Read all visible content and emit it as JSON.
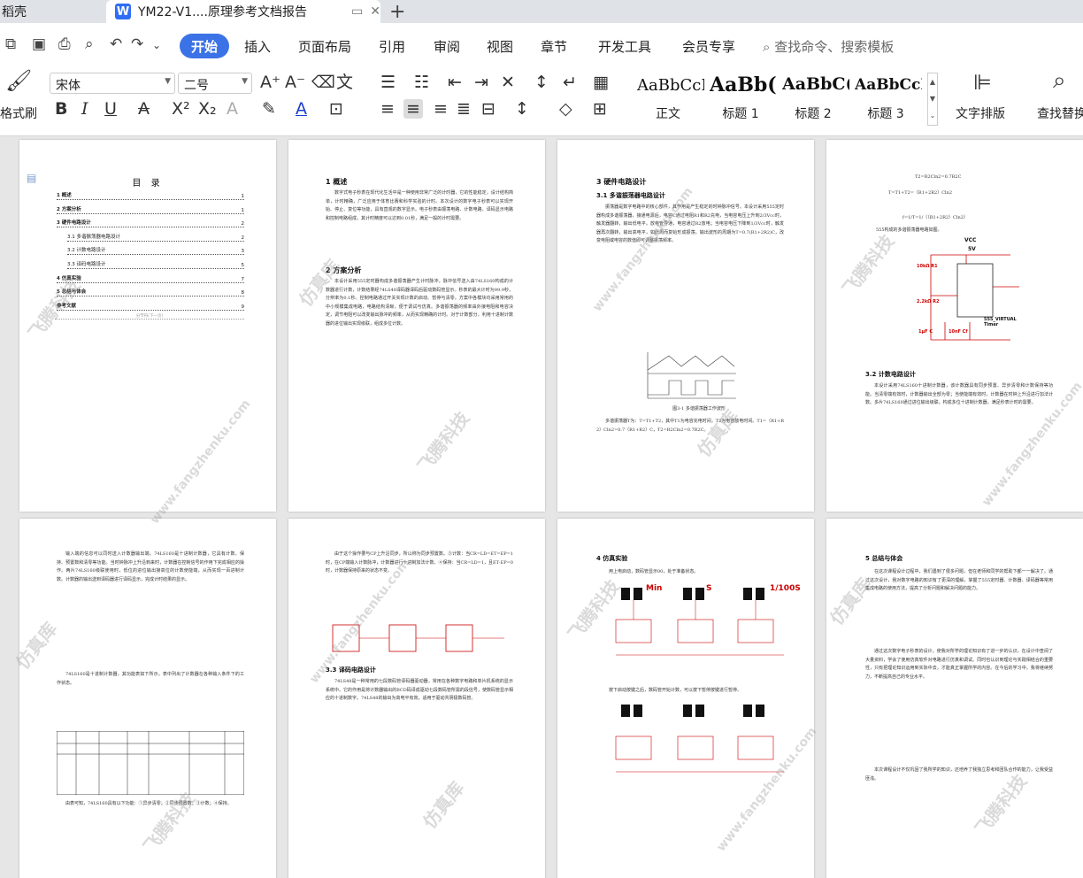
{
  "tabs": {
    "left_tab": "稻壳",
    "active_doc_icon": "W",
    "active_tab": "YM22-V1....原理参考文档报告",
    "new_tab": "+"
  },
  "menu": {
    "items": [
      "开始",
      "插入",
      "页面布局",
      "引用",
      "审阅",
      "视图",
      "章节",
      "开发工具",
      "会员专享"
    ],
    "active": "开始",
    "search": "查找命令、搜索模板"
  },
  "ribbon": {
    "format_painter": "格式刷",
    "font_name": "宋体",
    "font_size": "二号",
    "styles": [
      {
        "sample": "AaBbCcI",
        "name": "正文"
      },
      {
        "sample": "AaBb(",
        "name": "标题 1"
      },
      {
        "sample": "AaBbC(",
        "name": "标题 2"
      },
      {
        "sample": "AaBbCcI",
        "name": "标题 3"
      }
    ],
    "text_layout": "文字排版",
    "find_replace": "查找替换"
  },
  "watermark": {
    "text1": "飞腾科技",
    "text2": "仿真库",
    "url": "www.fangzhenku.com"
  },
  "pages": {
    "p1": {
      "title": "目 录",
      "toc": [
        {
          "t": "1 概述",
          "n": "1",
          "bold": true
        },
        {
          "t": "2 方案分析",
          "n": "1",
          "bold": true
        },
        {
          "t": "3 硬件电路设计",
          "n": "2",
          "bold": true
        },
        {
          "t": "3.1 多谐振荡器电路设计",
          "n": "2",
          "bold": false
        },
        {
          "t": "3.2 计数电路设计",
          "n": "3",
          "bold": false
        },
        {
          "t": "3.3 译码电路设计",
          "n": "5",
          "bold": false
        },
        {
          "t": "4 仿真实验",
          "n": "7",
          "bold": true
        },
        {
          "t": "5 总结与体会",
          "n": "8",
          "bold": true
        },
        {
          "t": "参考文献",
          "n": "9",
          "bold": true
        }
      ],
      "section_break": "分节符(下一页)"
    },
    "p2": {
      "h1": "1 概述",
      "t1": "数字式电子秒表在现代化生活中是一种使用非常广泛的计时器，它的性能稳定，设计结构简单，计时精确，广泛应用于体育比赛和科学实验的计时。本次设计的数字电子秒表可以实现开始、停止、复位等功能，具有直观的数字显示。电子秒表由振荡电路、计数电路、译码显示电路和控制电路组成，其计时精度可以达到0.01秒，满足一般的计时需要。",
      "h2": "2 方案分析",
      "t2": "本设计采用555定时器构成多谐振荡器产生计时脉冲，脉冲信号送入由74LS160构成的计数器进行计数，计数结果经74LS48译码器译码后驱动数码管显示。秒表的最大计时为99.9秒，分辨率为0.1秒。控制电路通过开关实现计数的启动、暂停与清零。方案中各模块均采用常用的中小规模集成电路，电路结构清晰，便于调试与仿真。多谐振荡器的频率由外接电阻和电容决定，调节电阻可以改变输出脉冲的频率，从而实现精确的计时。对于计数部分，利用十进制计数器的进位输出实现级联，组成多位计数。"
    },
    "p3": {
      "h1": "3 硬件电路设计",
      "h2": "3.1 多谐振荡器电路设计",
      "t1": "振荡器是数字电路中的核心部件，其作用是产生稳定的时钟脉冲信号。本设计采用555定时器构成多谐振荡器，接通电源后，电容C通过电阻R1和R2充电，当电容电压上升到2/3Vcc时，触发器翻转，输出低电平，放电管导通，电容通过R2放电；当电容电压下降到1/3Vcc时，触发器再次翻转，输出高电平，如此周而复始形成振荡。输出波形的周期为T=0.7(R1+2R2)C，改变电阻或电容的数值即可调整振荡频率。",
      "caption": "图3-1 多谐振荡器工作波形",
      "t2": "多谐振荡器T为：T=T1+T2，其中T1为电容充电时间，T2为电容放电时间。T1=（R1+R2）Cln2=0.7（R1+R2）C，T2=R2Cln2=0.7R2C。"
    },
    "p4": {
      "f1": "T2=R2Cln2=0.7R2C",
      "f2": "T=T1+T2=（R1+2R2）Cln2",
      "f3": "f=1/T=1/（（R1+2R2）Cln2）",
      "t0": "555构成的多谐振荡器电路如图。",
      "vcc": "VCC",
      "v5": "5V",
      "r1": "10kΩ R1",
      "r2": "2.2kΩ R2",
      "c1": "1μF C",
      "c2": "10nF Cf",
      "chip": "555_VIRTUAL Timer",
      "h1": "3.2 计数电路设计",
      "t1": "本设计采用74LS160十进制计数器，该计数器具有同步预置、异步清零和计数保持等功能。当清零端有效时，计数器输出全部为零；当使能端有效时，计数器在时钟上升沿进行加法计数。多片74LS160通过进位输出级联，构成多位十进制计数器，满足秒表计时的需要。"
    },
    "p5": {
      "t1": "输入端的信息可以同时送入计数器输出端。74LS160是十进制计数器，它具有计数、保持、预置数和清零等功能。当时钟脉冲上升沿到来时，计数器在控制信号的作用下完成相应的操作。两片74LS160级联使用时，低位的进位输出接高位的计数使能端，从而实现一百进制计数。计数器的输出送到译码器进行译码显示，完成计时结果的显示。",
      "t2": "74LS160是十进制计数器，其功能表如下所示。表中列出了计数器在各种输入条件下的工作状态。",
      "t3": "由表可知，74LS160具有以下功能：①异步清零；②同步预置数；③计数；④保持。"
    },
    "p6": {
      "t1": "由于这个操作要与CP上升沿同步，所以称为同步预置数。③计数：当CR=LD=ET=EP=1时，在CP端输入计数脉冲，计数器进行十进制加法计数。④保持：当CR=LD=1，且ET·EP=0时，计数器保持原来的状态不变。",
      "h1": "3.3 译码电路设计",
      "t2": "74LS48是一种常用的七段数码管译码器驱动器，常用在各种数字电路和单片机系统的显示系统中。它的作用是将计数器输出的BCD码译成驱动七段数码管所需的段信号，使数码管显示相应的十进制数字。74LS48的输出为高电平有效，适用于驱动共阴极数码管。"
    },
    "p7": {
      "h1": "4 仿真实验",
      "t1": "用上电启动，数码管显示00，处于准备状态。",
      "l1": "Min",
      "l2": "S",
      "l3": "1/100S",
      "t2": "按下启动按键之后，数码管开始计数，可以按下暂停按键进行暂停。"
    },
    "p8": {
      "h1": "5 总结与体会",
      "t1": "在这次课程设计过程中，我们遇到了很多问题，但在老师和同学的帮助下都一一解决了。通过这次设计，我对数字电路的知识有了更深的理解，掌握了555定时器、计数器、译码器等常用集成电路的使用方法，提高了分析问题和解决问题的能力。",
      "t2": "通过这次数字电子秒表的设计，使我对所学的理论知识有了进一步的认识，在设计中查阅了大量资料，学会了使用仿真软件对电路进行仿真和调试。同时也认识到理论与实践相结合的重要性，只有把理论知识运用到实际中去，才能真正掌握所学的内容。在今后的学习中，我将继续努力，不断提高自己的专业水平。",
      "t3": "本次课程设计不仅巩固了我所学的知识，还培养了我独立思考和团队合作的能力，让我受益匪浅。"
    }
  }
}
